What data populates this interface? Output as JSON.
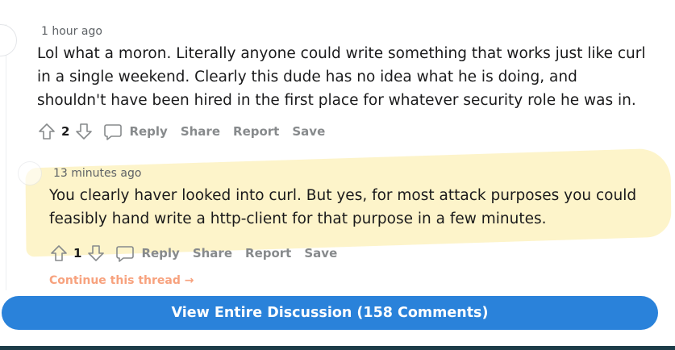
{
  "comments": [
    {
      "time": "1 hour ago",
      "text": "Lol what a moron. Literally anyone could write something that works just like curl in a single weekend. Clearly this dude has no idea what he is doing, and shouldn't have been hired in the first place for whatever security role he was in.",
      "score": "2",
      "actions": {
        "reply": "Reply",
        "share": "Share",
        "report": "Report",
        "save": "Save"
      }
    },
    {
      "time": "13 minutes ago",
      "text": "You clearly haver looked into curl. But yes, for most attack purposes you could feasibly hand write a http-client for that purpose in a few minutes.",
      "score": "1",
      "actions": {
        "reply": "Reply",
        "share": "Share",
        "report": "Report",
        "save": "Save"
      }
    }
  ],
  "continue_thread": "Continue this thread →",
  "view_discussion": "View Entire Discussion (158 Comments)",
  "icons": {
    "upvote": "upvote-arrow-icon",
    "downvote": "downvote-arrow-icon",
    "reply": "chat-bubble-icon"
  },
  "colors": {
    "accent": "#2a82da",
    "highlight": "#fdf3c4",
    "action_text": "#878a8c",
    "continue_link": "#f7a27e"
  }
}
